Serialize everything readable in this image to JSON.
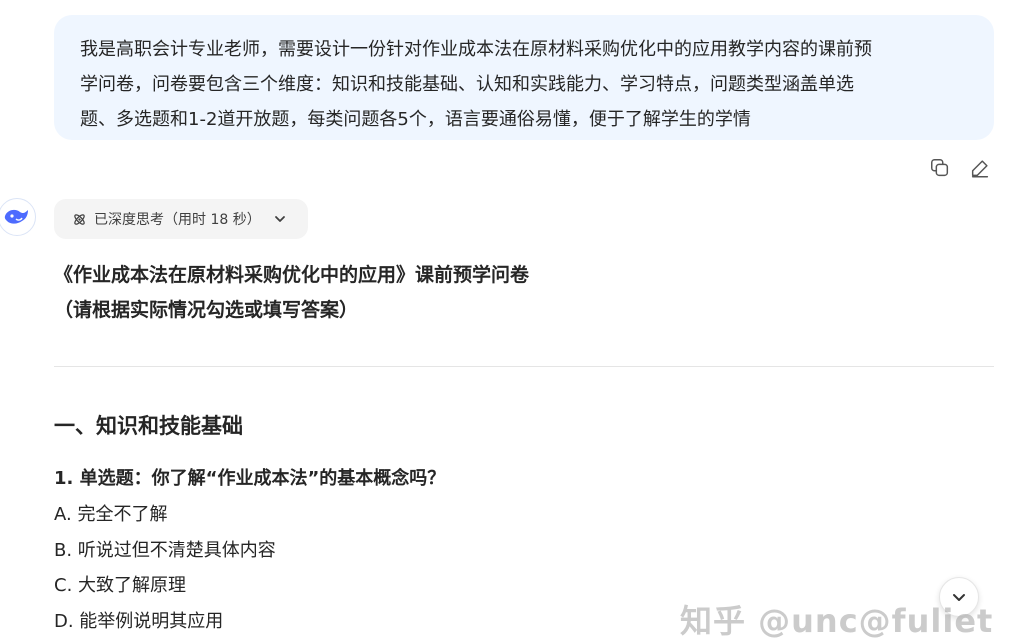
{
  "user_message": {
    "lines": [
      "我是高职会计专业老师，需要设计一份针对作业成本法在原材料采购优化中的应用教学内容的课前预",
      "学问卷，问卷要包含三个维度：知识和技能基础、认知和实践能力、学习特点，问题类型涵盖单选",
      "题、多选题和1-2道开放题，每类问题各5个，语言要通俗易懂，便于了解学生的学情"
    ]
  },
  "message_actions": {
    "copy_icon": "copy-icon",
    "edit_icon": "edit-icon"
  },
  "assistant": {
    "avatar_icon": "deepseek-whale-icon",
    "thinking_label": "已深度思考（用时 18 秒）",
    "doc_title": "《作业成本法在原材料采购优化中的应用》课前预学问卷",
    "doc_subtitle": "（请根据实际情况勾选或填写答案）",
    "section_heading": "一、知识和技能基础",
    "question_1": "1. 单选题：你了解“作业成本法”的基本概念吗？",
    "options": [
      "A. 完全不了解",
      "B. 听说过但不清楚具体内容",
      "C. 大致了解原理",
      "D. 能举例说明其应用"
    ]
  },
  "watermark": "知乎 @unc@fuliet",
  "colors": {
    "user_bubble": "#eff6ff",
    "text": "#262626",
    "accent": "#4d6bfe"
  }
}
